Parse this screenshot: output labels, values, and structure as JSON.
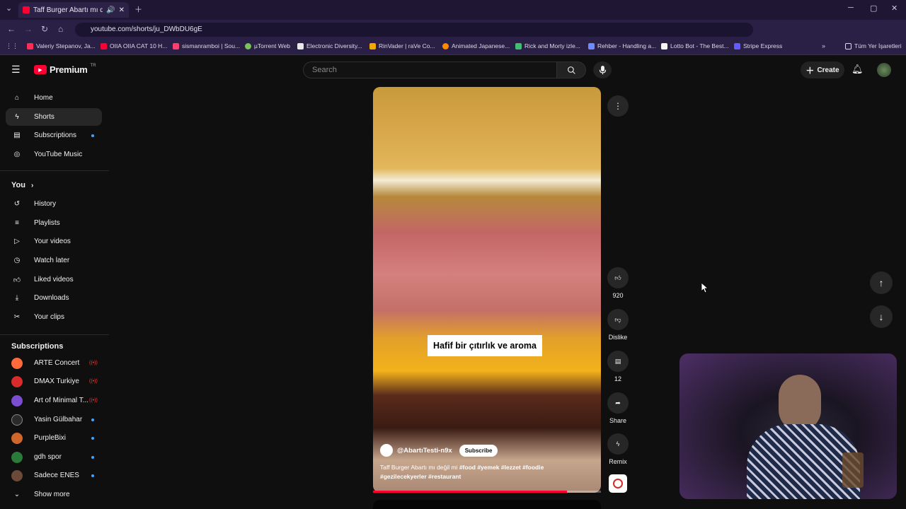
{
  "browser": {
    "tab_title": "Taff Burger Abartı mı değil mi",
    "url": "youtube.com/shorts/ju_DWbDU6gE",
    "bookmarks": [
      {
        "label": "Valeriy Stepanov, Ja...",
        "color": "#ff2d55"
      },
      {
        "label": "OIIA OIIA CAT 10 H...",
        "color": "#ff0033"
      },
      {
        "label": "sismanramboi | Sou...",
        "color": "#ff3d6e"
      },
      {
        "label": "µTorrent Web",
        "color": "#78c257"
      },
      {
        "label": "Electronic Diversity...",
        "color": "#e8e8e8"
      },
      {
        "label": "RinVader | raVe Co...",
        "color": "#f2a900"
      },
      {
        "label": "Animated Japanese...",
        "color": "#ff8a00"
      },
      {
        "label": "Rick and Morty izle...",
        "color": "#3fbf6f"
      },
      {
        "label": "Rehber - Handling a...",
        "color": "#6b8cff"
      },
      {
        "label": "Lotto Bot - The Best...",
        "color": "#f5f5f5"
      },
      {
        "label": "Stripe Express",
        "color": "#635bff"
      }
    ],
    "all_bookmarks": "Tüm Yer İşaretleri"
  },
  "header": {
    "logo": "Premium",
    "logo_region": "TR",
    "search_placeholder": "Search",
    "create_label": "Create"
  },
  "sidebar": {
    "main": [
      {
        "label": "Home",
        "icon": "home-icon"
      },
      {
        "label": "Shorts",
        "icon": "shorts-icon",
        "active": true
      },
      {
        "label": "Subscriptions",
        "icon": "subscriptions-icon",
        "dot": true
      },
      {
        "label": "YouTube Music",
        "icon": "music-icon"
      }
    ],
    "you_label": "You",
    "you": [
      {
        "label": "History",
        "icon": "history-icon"
      },
      {
        "label": "Playlists",
        "icon": "playlists-icon"
      },
      {
        "label": "Your videos",
        "icon": "your-videos-icon"
      },
      {
        "label": "Watch later",
        "icon": "watch-later-icon"
      },
      {
        "label": "Liked videos",
        "icon": "liked-icon"
      },
      {
        "label": "Downloads",
        "icon": "download-icon"
      },
      {
        "label": "Your clips",
        "icon": "clips-icon"
      }
    ],
    "subs_label": "Subscriptions",
    "subs": [
      {
        "label": "ARTE Concert",
        "color": "#ff6a3d",
        "badge": "live"
      },
      {
        "label": "DMAX Turkiye",
        "color": "#d92b2b",
        "badge": "live"
      },
      {
        "label": "Art of Minimal T...",
        "color": "#7a4dd1",
        "badge": "live"
      },
      {
        "label": "Yasin Gülbahar",
        "color": "#2a2a2a",
        "badge": "dot"
      },
      {
        "label": "PurpleBixi",
        "color": "#d0662b",
        "badge": "dot"
      },
      {
        "label": "gdh spor",
        "color": "#2a7a3a",
        "badge": "dot"
      },
      {
        "label": "Sadece ENES",
        "color": "#6b4a3a",
        "badge": "dot"
      }
    ],
    "show_more": "Show more"
  },
  "short": {
    "caption_overlay": "Hafif bir çıtırlık ve aroma",
    "channel": "@AbartıTesti-n9x",
    "subscribe": "Subscribe",
    "title_plain": "Taff Burger Abartı mı değil mi",
    "hashtags_line1": "#food #yemek #lezzet #foodie",
    "hashtags_line2": "#gezilecekyerler #restaurant",
    "progress": 0.85
  },
  "actions": {
    "likes": "920",
    "dislike": "Dislike",
    "comments": "12",
    "share": "Share",
    "remix": "Remix"
  }
}
